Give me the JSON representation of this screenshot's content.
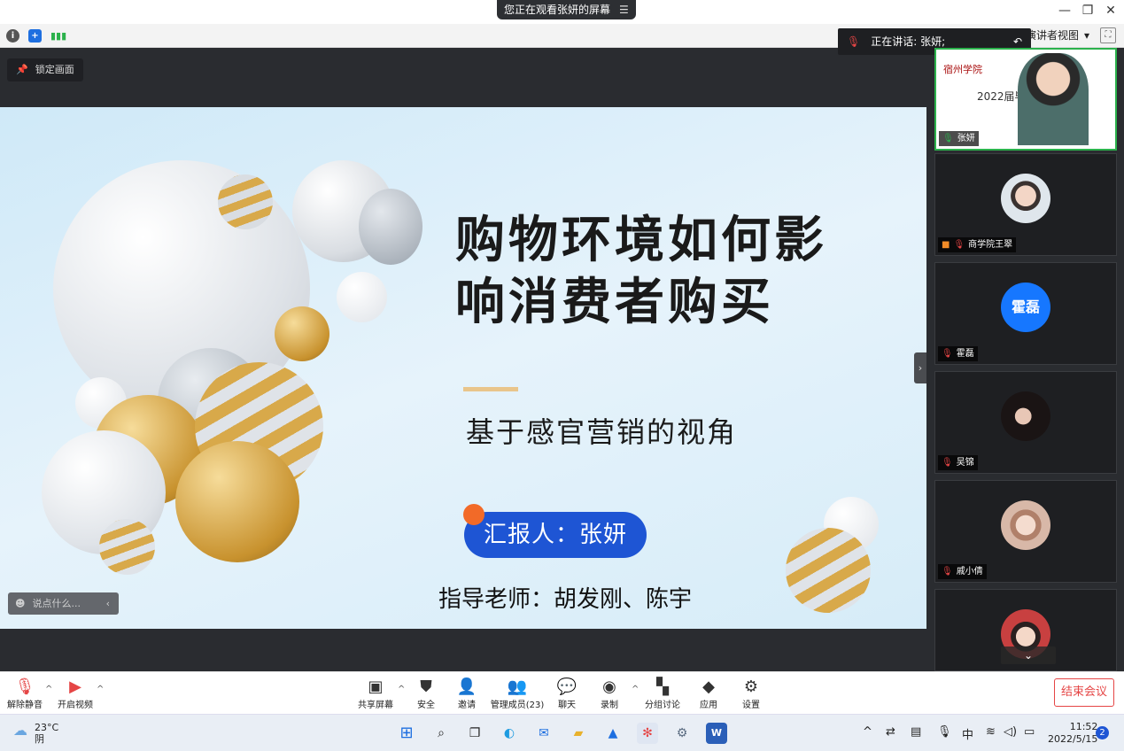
{
  "titlebar": {
    "sharing_text": "您正在观看张妍的屏幕",
    "minimize": "—",
    "restore": "❐",
    "close": "✕"
  },
  "infobar": {
    "view_label": "演讲者视图",
    "view_caret": "▾"
  },
  "speaking": {
    "label": "正在讲话: 张妍;"
  },
  "lock_label": "锁定画面",
  "slide": {
    "title_line1": "购物环境如何影",
    "title_line2": "响消费者购买",
    "subtitle": "基于感官营销的视角",
    "presenter": "汇报人：张妍",
    "advisor": "指导老师：胡发刚、陈宇"
  },
  "chat_input": {
    "placeholder": "说点什么..."
  },
  "participants": [
    {
      "name": "张妍",
      "initials": "",
      "slide_thumb_title": "2022届毕　　　　答辩",
      "school": "宿州学院"
    },
    {
      "name": "商学院王翠"
    },
    {
      "name": "霍磊",
      "initials": "霍磊"
    },
    {
      "name": "吴锦"
    },
    {
      "name": "戚小倩"
    },
    {
      "name": ""
    }
  ],
  "toolbar": {
    "unmute": "解除静音",
    "video": "开启视频",
    "share": "共享屏幕",
    "security": "安全",
    "invite": "邀请",
    "members": "管理成员(23)",
    "chat": "聊天",
    "record": "录制",
    "breakout": "分组讨论",
    "apps": "应用",
    "settings": "设置",
    "end": "结束会议"
  },
  "taskbar": {
    "temp": "23°C",
    "weather": "阴",
    "ime": "中",
    "time": "11:52",
    "date": "2022/5/15",
    "notifications": "2"
  }
}
